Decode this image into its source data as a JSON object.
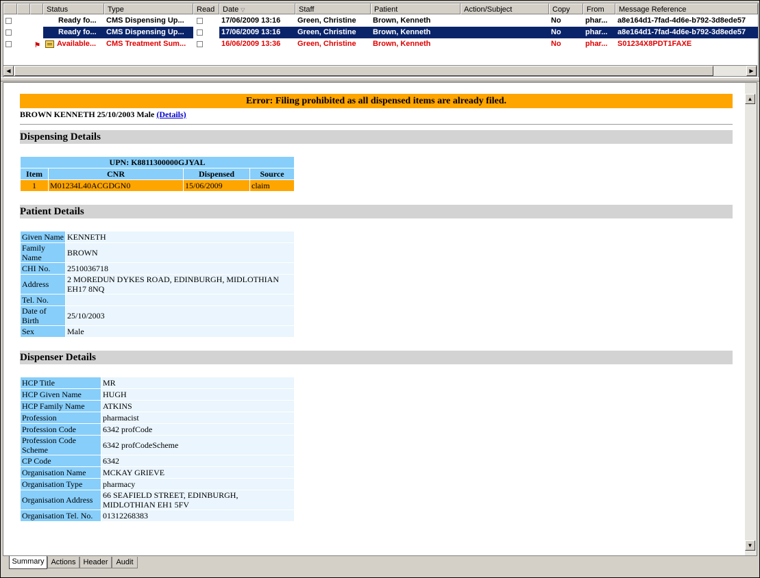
{
  "columns": [
    "Status",
    "Type",
    "Read",
    "Date",
    "Staff",
    "Patient",
    "Action/Subject",
    "Copy",
    "From",
    "Message Reference"
  ],
  "rows": [
    {
      "status": "Ready fo...",
      "type": "CMS Dispensing Up...",
      "date": "17/06/2009 13:16",
      "staff": "Green, Christine",
      "patient": "Brown, Kenneth",
      "action": "",
      "copy": "No",
      "from": "phar...",
      "ref": "a8e164d1-7fad-4d6e-b792-3d8ede57"
    },
    {
      "status": "Ready fo...",
      "type": "CMS Dispensing Up...",
      "date": "17/06/2009 13:16",
      "staff": "Green, Christine",
      "patient": "Brown, Kenneth",
      "action": "",
      "copy": "No",
      "from": "phar...",
      "ref": "a8e164d1-7fad-4d6e-b792-3d8ede57"
    },
    {
      "status": "Available...",
      "type": "CMS Treatment Sum...",
      "date": "16/06/2009 13:36",
      "staff": "Green, Christine",
      "patient": "Brown, Kenneth",
      "action": "",
      "copy": "No",
      "from": "phar...",
      "ref": "S01234X8PDT1FAXE"
    }
  ],
  "doc": {
    "error": "Error: Filing prohibited as all dispensed items are already filed.",
    "patient_line": "BROWN KENNETH 25/10/2003 Male",
    "details_link": "(Details)",
    "dispensing_title": "Dispensing Details",
    "upn": "UPN: K8811300000GJYAL",
    "disp_headers": [
      "Item",
      "CNR",
      "Dispensed",
      "Source"
    ],
    "disp_row": [
      "1",
      "M01234L40ACGDGN0",
      "15/06/2009",
      "claim"
    ],
    "patient_title": "Patient Details",
    "patient_rows": [
      {
        "k": "Given Name",
        "v": "KENNETH"
      },
      {
        "k": "Family Name",
        "v": "BROWN"
      },
      {
        "k": "CHI No.",
        "v": "2510036718"
      },
      {
        "k": "Address",
        "v": "2 MOREDUN DYKES ROAD, EDINBURGH, MIDLOTHIAN EH17 8NQ"
      },
      {
        "k": "Tel. No.",
        "v": ""
      },
      {
        "k": "Date of Birth",
        "v": "25/10/2003"
      },
      {
        "k": "Sex",
        "v": "Male"
      }
    ],
    "dispenser_title": "Dispenser Details",
    "dispenser_rows": [
      {
        "k": "HCP Title",
        "v": "MR"
      },
      {
        "k": "HCP Given Name",
        "v": "HUGH"
      },
      {
        "k": "HCP Family Name",
        "v": "ATKINS"
      },
      {
        "k": "Profession",
        "v": "pharmacist"
      },
      {
        "k": "Profession Code",
        "v": "6342 profCode"
      },
      {
        "k": "Profession Code Scheme",
        "v": "6342 profCodeScheme"
      },
      {
        "k": "CP Code",
        "v": "6342"
      },
      {
        "k": "Organisation Name",
        "v": "MCKAY GRIEVE"
      },
      {
        "k": "Organisation Type",
        "v": "pharmacy"
      },
      {
        "k": "Organisation Address",
        "v": "66 SEAFIELD STREET, EDINBURGH, MIDLOTHIAN EH1 5FV"
      },
      {
        "k": "Organisation Tel. No.",
        "v": "01312268383"
      }
    ]
  },
  "tabs": [
    "Summary",
    "Actions",
    "Header",
    "Audit"
  ],
  "colors": {
    "selection": "#0a246a",
    "error_bg": "#ffa500",
    "key_bg": "#87cefa",
    "unread_red": "#e00000"
  }
}
